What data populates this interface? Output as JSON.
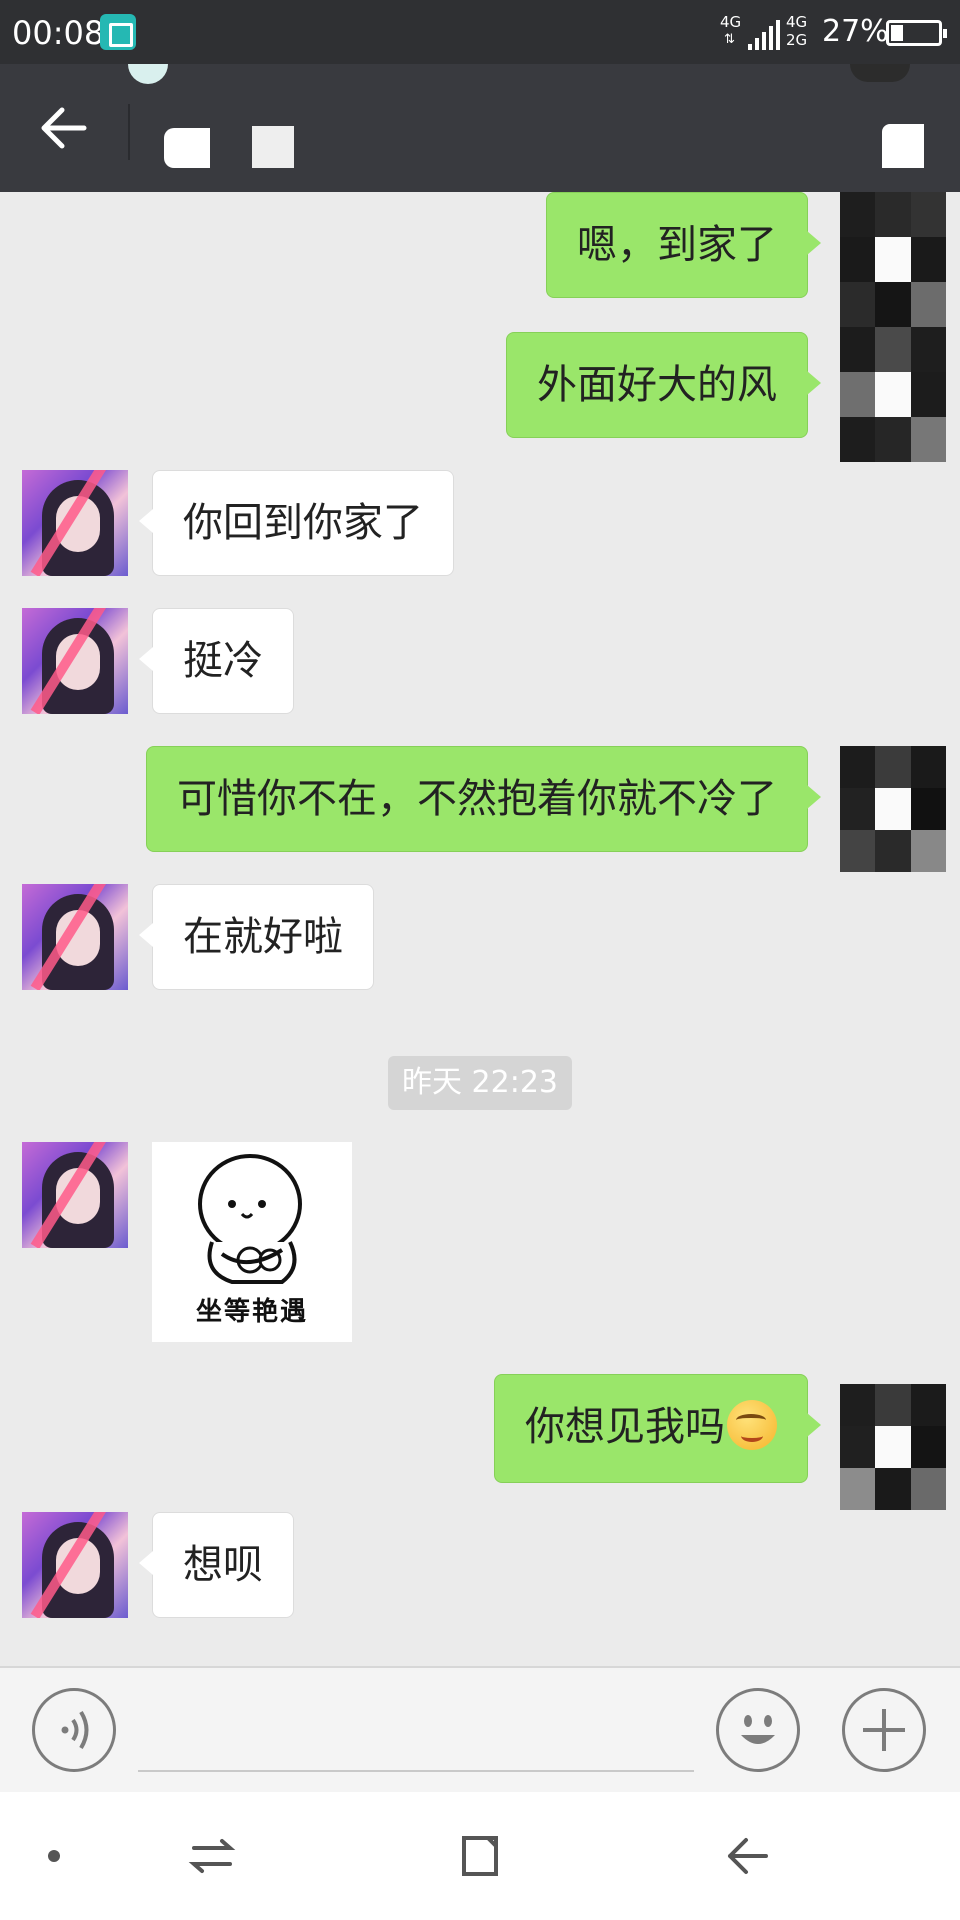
{
  "status_bar": {
    "time": "00:08",
    "net_top": "4G",
    "net_right_top": "4G",
    "net_right_bottom": "2G",
    "battery_percent": "27%",
    "battery_level": 0.27
  },
  "header": {
    "back_icon": "arrow-left-icon",
    "menu_icon": "profile-icon"
  },
  "messages": [
    {
      "side": "out",
      "text": "嗯，到家了"
    },
    {
      "side": "out",
      "text": "外面好大的风"
    },
    {
      "side": "in",
      "text": "你回到你家了"
    },
    {
      "side": "in",
      "text": "挺冷"
    },
    {
      "side": "out",
      "text": "可惜你不在，不然抱着你就不冷了"
    },
    {
      "side": "in",
      "text": "在就好啦"
    },
    {
      "side": "in",
      "type": "sticker",
      "caption": "坐等艳遇"
    },
    {
      "side": "out",
      "text": "你想见我吗",
      "emoji": "smirk-face-icon"
    },
    {
      "side": "in",
      "text": "想呗"
    }
  ],
  "timestamp": "昨天 22:23",
  "input": {
    "placeholder": "",
    "voice_icon": "voice-icon",
    "emoji_icon": "smile-icon",
    "plus_icon": "plus-icon"
  },
  "colors": {
    "outgoing_bubble": "#9ae66a",
    "incoming_bubble": "#ffffff",
    "header_bg": "#393a3f",
    "chat_bg": "#ebebeb"
  }
}
